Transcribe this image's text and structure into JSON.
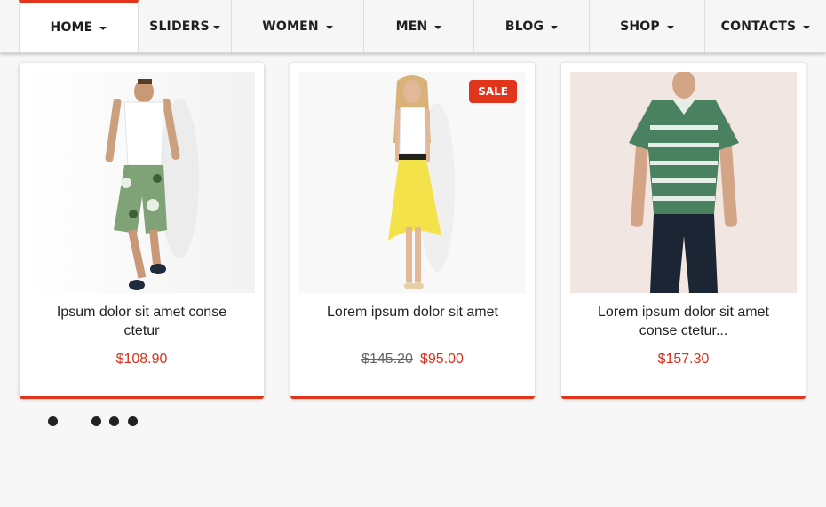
{
  "nav": {
    "items": [
      {
        "label": "HOME"
      },
      {
        "label": "SLIDERS"
      },
      {
        "label": "WOMEN"
      },
      {
        "label": "MEN"
      },
      {
        "label": "BLOG"
      },
      {
        "label": "SHOP"
      },
      {
        "label": "CONTACTS"
      }
    ],
    "active_index": 0
  },
  "products": [
    {
      "title_lines": [
        "Ipsum dolor sit amet conse",
        "ctetur"
      ],
      "price": "$108.90",
      "old_price": "",
      "badge": ""
    },
    {
      "title_lines": [
        "Lorem ipsum dolor sit amet",
        ""
      ],
      "price": "$95.00",
      "old_price": "$145.20",
      "badge": "SALE"
    },
    {
      "title_lines": [
        "Lorem ipsum dolor sit amet",
        "conse ctetur..."
      ],
      "price": "$157.30",
      "old_price": "",
      "badge": ""
    }
  ],
  "colors": {
    "accent": "#e0341b",
    "price": "#d9301a",
    "background": "#f7f7f7"
  },
  "pagination": {
    "dot_count": 4
  }
}
